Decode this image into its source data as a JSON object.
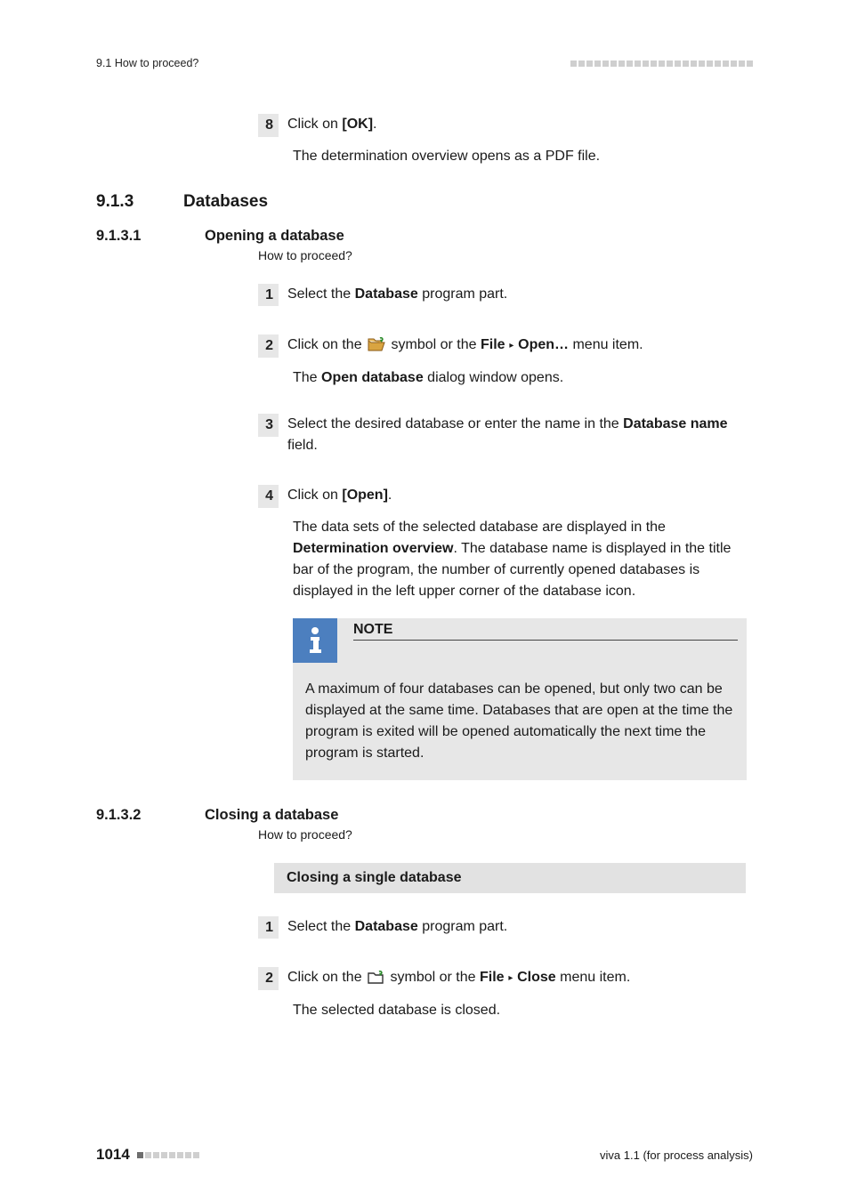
{
  "header": {
    "section": "9.1 How to proceed?"
  },
  "intro": {
    "step8": {
      "num": "8",
      "text_a": "Click on ",
      "button": "[OK]",
      "text_b": ".",
      "after": "The determination overview opens as a PDF file."
    }
  },
  "h913": {
    "num": "9.1.3",
    "title": "Databases"
  },
  "h9131": {
    "num": "9.1.3.1",
    "title": "Opening a database",
    "sub": "How to proceed?"
  },
  "open_steps": {
    "s1": {
      "num": "1",
      "a": "Select the ",
      "b": "Database",
      "c": " program part."
    },
    "s2": {
      "num": "2",
      "a": "Click on the ",
      "b": " symbol or the ",
      "file": "File",
      "open": "Open…",
      "c": " menu item.",
      "after_a": "The ",
      "after_b": "Open database",
      "after_c": " dialog window opens."
    },
    "s3": {
      "num": "3",
      "a": "Select the desired database or enter the name in the ",
      "b": "Database name",
      "c": " field."
    },
    "s4": {
      "num": "4",
      "a": "Click on ",
      "b": "[Open]",
      "c": ".",
      "after_a": "The data sets of the selected database are displayed in the ",
      "after_b": "Determination overview",
      "after_c": ". The database name is displayed in the title bar of the program, the number of currently opened databases is displayed in the left upper corner of the database icon."
    }
  },
  "note": {
    "title": "NOTE",
    "body": "A maximum of four databases can be opened, but only two can be displayed at the same time. Databases that are open at the time the program is exited will be opened automatically the next time the program is started."
  },
  "h9132": {
    "num": "9.1.3.2",
    "title": "Closing a database",
    "sub": "How to proceed?"
  },
  "closing_bar": "Closing a single database",
  "close_steps": {
    "s1": {
      "num": "1",
      "a": "Select the ",
      "b": "Database",
      "c": " program part."
    },
    "s2": {
      "num": "2",
      "a": "Click on the ",
      "b": " symbol or the ",
      "file": "File",
      "close": "Close",
      "c": " menu item.",
      "after": "The selected database is closed."
    }
  },
  "footer": {
    "page": "1014",
    "product": "viva 1.1 (for process analysis)"
  }
}
